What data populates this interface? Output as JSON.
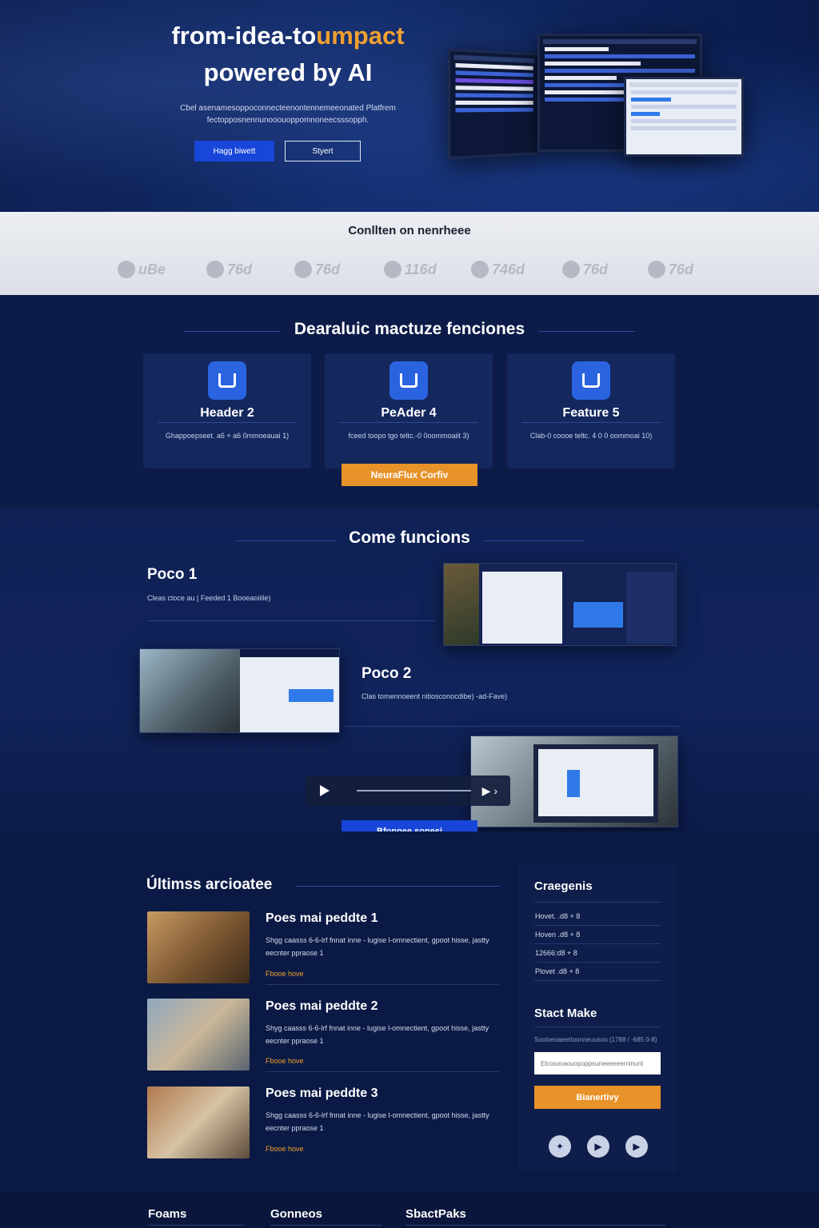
{
  "hero": {
    "title_part1": "from-idea-to",
    "title_accent": "umpact",
    "title_line2": "powered by AI",
    "subtitle": "Cbel asenamesoppoconnecteenontennemeeonated Platfrem fectopposnennunooouoppomnoneecsssopph.",
    "primary_button": "Hagg biwett",
    "secondary_button": "Styert"
  },
  "clients": {
    "title": "Conllten on nenrheee",
    "logos": [
      "uBe",
      "76d",
      "76d",
      "116d",
      "746d",
      "76d",
      "76d"
    ]
  },
  "features": {
    "title": "Dearaluic mactuze fenciones",
    "cards": [
      {
        "title": "Header 2",
        "desc": "Ghappoepseet. a6 + a6 0mmoeauai 1)"
      },
      {
        "title": "PeAder 4",
        "desc": "fceed toopo tgo teltc.-0 0oommoaiit 3)"
      },
      {
        "title": "Feature 5",
        "desc": "Clab-0 coooe teltc. 4 0 0 oommoai 10)"
      }
    ],
    "cta": "NeuraFlux Corfiv"
  },
  "how": {
    "title": "Come funcions",
    "steps": [
      {
        "title": "Poco 1",
        "desc": "Cleas ctoce au | Feeded 1 Booeaoiiile)"
      },
      {
        "title": "Poco 2",
        "desc": "Clas tomennoeent nitiosconocdibe) -ad-Fave)"
      }
    ],
    "cta": "Bfonnee sonesi"
  },
  "articles": {
    "title": "Últimss arcioatee",
    "items": [
      {
        "title": "Poes mai peddte 1",
        "excerpt": "Shgg caasss 6-6-lrf fnnat inne - lugise l-omnectient, gpoot hisse, jastty eecnter ppraose 1",
        "link": "Fbooe hove"
      },
      {
        "title": "Poes mai peddte 2",
        "excerpt": "Shyg caasss 6-6-lrf fnnat inne - lugise l-omnectient, gpoot hisse, jastty eecnter ppraose 1",
        "link": "Fbooe hove"
      },
      {
        "title": "Poes mai peddte 3",
        "excerpt": "Shgg caasss 6-6-lrf fnnat inne - lugise l-omnectient, gpoot hisse, jastty eecnter ppraose 1",
        "link": "Fbooe hove"
      }
    ]
  },
  "sidebar": {
    "categories_title": "Craegenis",
    "categories": [
      "Hovet. .d8 + 8",
      "Hoven .d8 + 8",
      "12666:d8 + 8",
      "Plovet .d8 + 8"
    ],
    "newsletter_title": "Stact Make",
    "newsletter_text": "Sootoeoaeettoonneuusoo (1788 / -685 0-8)",
    "newsletter_placeholder": "Elcosooaouopoppsuneeeeeerninunt",
    "newsletter_button": "Bianertivy",
    "social_icons": [
      "pin-icon",
      "play-icon",
      "play-icon"
    ]
  },
  "footer": {
    "columns": [
      "Foams",
      "Gonneos",
      "SbactPaks"
    ]
  }
}
